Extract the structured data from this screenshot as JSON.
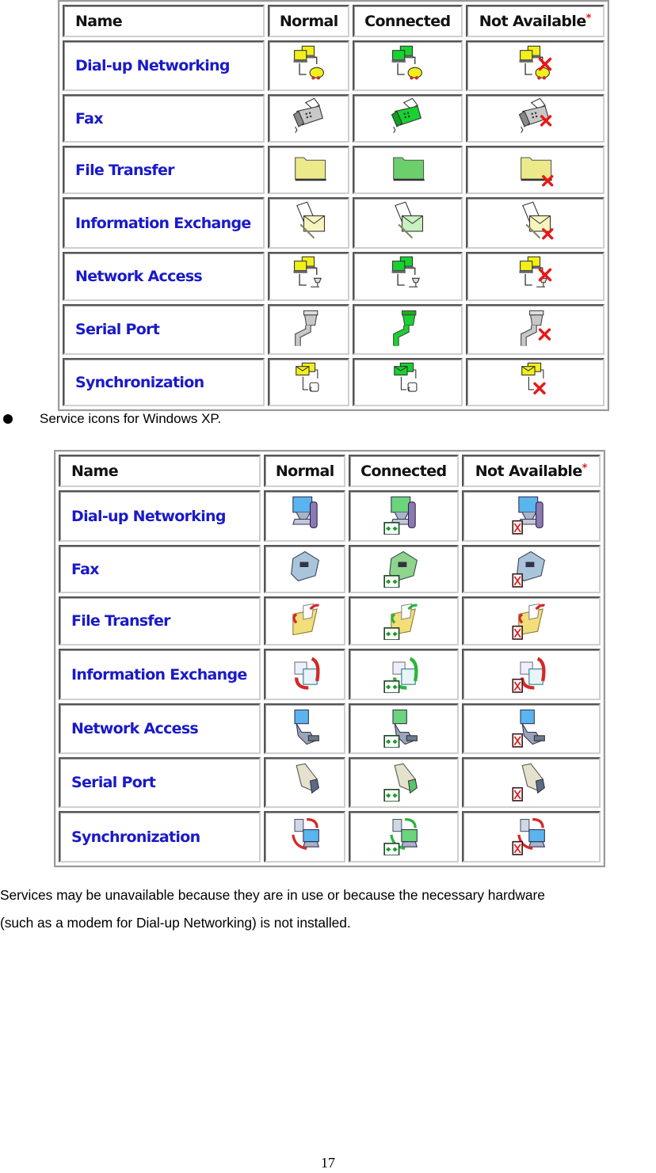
{
  "colors": {
    "service_name": "#1a1ac8",
    "asterisk": "#e01818",
    "normal_accent": "#f2ef1a",
    "connected_accent": "#18d230",
    "unavailable_mark": "#e81818",
    "xp_connected_badge": "#1a9a2a"
  },
  "table_legacy": {
    "headers": {
      "name": "Name",
      "normal": "Normal",
      "connected": "Connected",
      "not_available": "Not Available",
      "asterisk": "*"
    },
    "rows": [
      {
        "name": "Dial-up Networking",
        "icon": "dialup-networking-icon"
      },
      {
        "name": "Fax",
        "icon": "fax-icon"
      },
      {
        "name": "File Transfer",
        "icon": "folder-icon"
      },
      {
        "name": "Information Exchange",
        "icon": "information-exchange-icon"
      },
      {
        "name": "Network Access",
        "icon": "network-access-icon"
      },
      {
        "name": "Serial Port",
        "icon": "serial-port-icon"
      },
      {
        "name": "Synchronization",
        "icon": "synchronization-icon"
      }
    ],
    "states": [
      "normal",
      "connected",
      "not_available"
    ]
  },
  "bullet": {
    "text": "Service icons for Windows XP."
  },
  "table_xp": {
    "headers": {
      "name": "Name",
      "normal": "Normal",
      "connected": "Connected",
      "not_available": "Not Available",
      "asterisk": "*"
    },
    "rows": [
      {
        "name": "Dial-up Networking",
        "icon": "xp-dialup-networking-icon"
      },
      {
        "name": "Fax",
        "icon": "xp-fax-icon"
      },
      {
        "name": "File Transfer",
        "icon": "xp-file-transfer-icon"
      },
      {
        "name": "Information Exchange",
        "icon": "xp-information-exchange-icon"
      },
      {
        "name": "Network Access",
        "icon": "xp-network-access-icon"
      },
      {
        "name": "Serial Port",
        "icon": "xp-serial-port-icon"
      },
      {
        "name": "Synchronization",
        "icon": "xp-synchronization-icon"
      }
    ],
    "states": [
      "normal",
      "connected",
      "not_available"
    ]
  },
  "paragraph": {
    "line1": "Services may be unavailable because they are in use or because the necessary hardware",
    "line2": "(such as a modem for Dial-up Networking) is not installed."
  },
  "page_number": "17"
}
